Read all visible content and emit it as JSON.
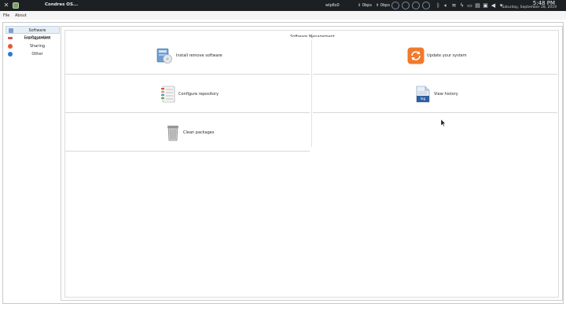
{
  "panel": {
    "window_title": "Condres OS...",
    "network_name": "wlp6s0",
    "down_speed": "0bps",
    "up_speed": "0bps",
    "clock_time": "5:48 PM",
    "clock_date": "Saturday, September 28, 2019"
  },
  "menubar": {
    "file_label": "File",
    "about_label": "About"
  },
  "sidebar": {
    "items": [
      {
        "label": "Software management",
        "icon": "package-icon",
        "color": "#7aa0c8",
        "active": true
      },
      {
        "label": "Configuration",
        "icon": "configuration-icon",
        "color": "#d9534f",
        "active": false
      },
      {
        "label": "Sharing",
        "icon": "sharing-icon",
        "color": "#e55b2f",
        "active": false
      },
      {
        "label": "Other",
        "icon": "other-icon",
        "color": "#2a7bd1",
        "active": false
      }
    ]
  },
  "main": {
    "title": "Software Management",
    "tiles": [
      {
        "label": "Install remove software",
        "icon": "install-software-icon"
      },
      {
        "label": "Update your system",
        "icon": "update-system-icon"
      },
      {
        "label": "Configure repository",
        "icon": "configure-repository-icon"
      },
      {
        "label": "View history",
        "icon": "log-file-icon",
        "icon_text": "log"
      },
      {
        "label": "Clean packages",
        "icon": "trash-bin-icon"
      }
    ]
  },
  "colors": {
    "panel_bg": "#1d2023",
    "accent_orange": "#f07a2c",
    "log_blue": "#2e5f9e"
  }
}
